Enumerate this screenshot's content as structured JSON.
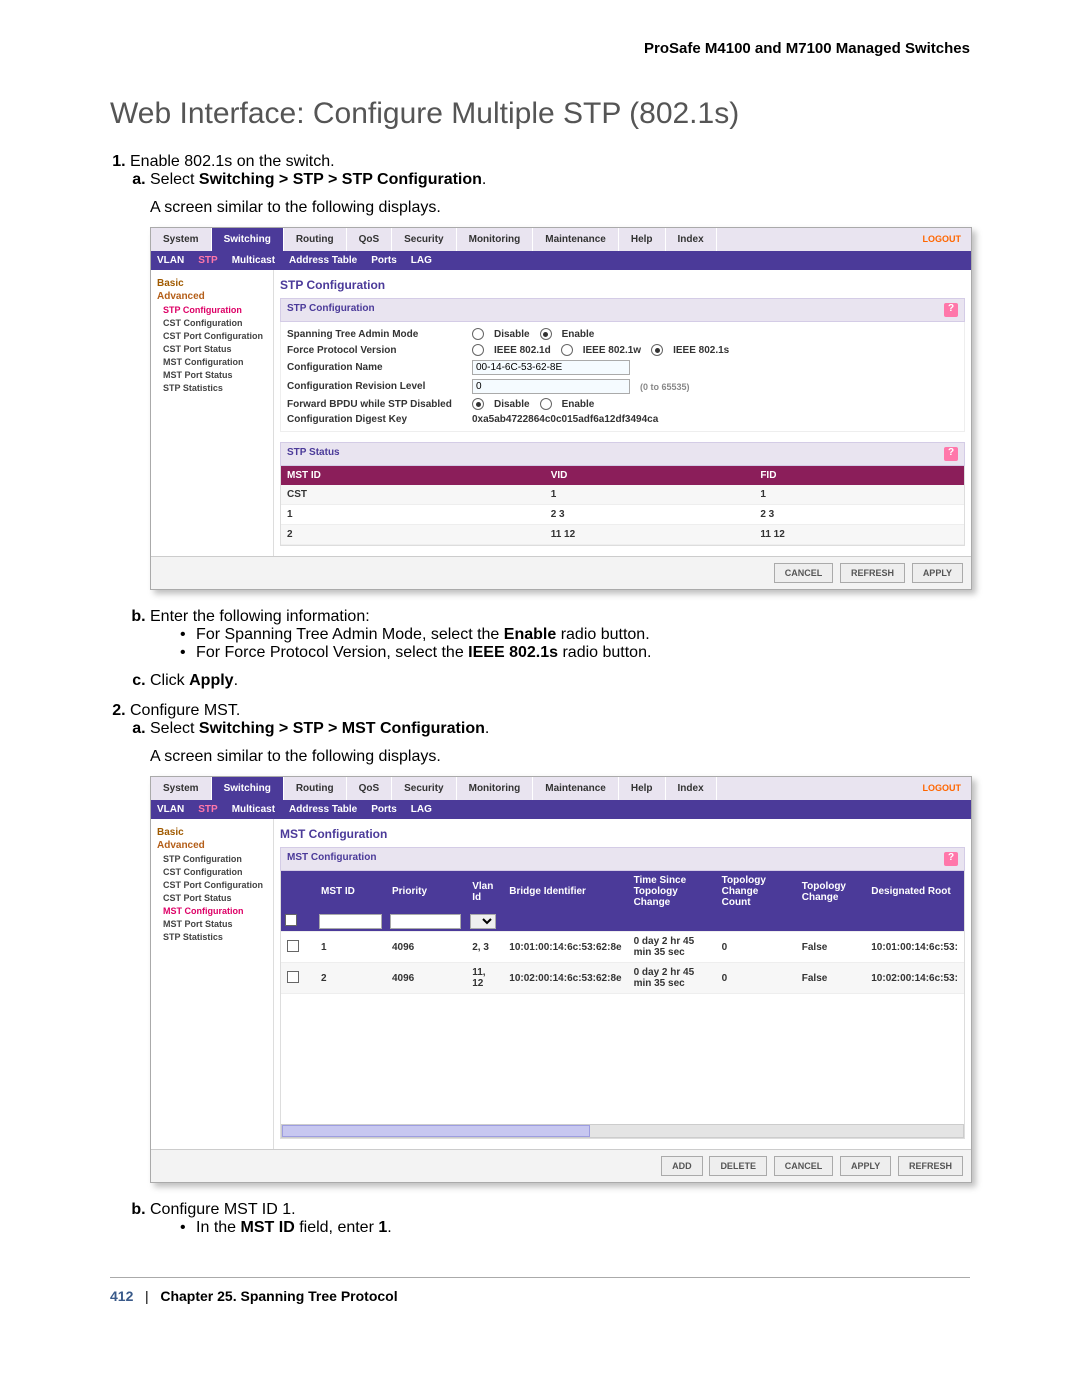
{
  "doc_header": "ProSafe M4100 and M7100 Managed Switches",
  "page_title": "Web Interface: Configure Multiple STP (802.1s)",
  "step1": {
    "text": "Enable 802.1s on the switch.",
    "a_prefix": "Select ",
    "a_path": "Switching > STP > STP Configuration",
    "a_suffix": ".",
    "a_desc": "A screen similar to the following displays.",
    "b_text": "Enter the following information:",
    "b_bullet1_pre": "For Spanning Tree Admin Mode, select the ",
    "b_bullet1_bold": "Enable",
    "b_bullet1_post": " radio button.",
    "b_bullet2_pre": "For Force Protocol Version, select the ",
    "b_bullet2_bold": "IEEE 802.1s",
    "b_bullet2_post": " radio button.",
    "c_pre": "Click ",
    "c_bold": "Apply",
    "c_post": "."
  },
  "step2": {
    "text": "Configure MST.",
    "a_prefix": "Select ",
    "a_path": "Switching > STP > MST Configuration",
    "a_suffix": ".",
    "a_desc": "A screen similar to the following displays.",
    "b_text": "Configure MST ID 1.",
    "b_bullet1_pre": "In the ",
    "b_bullet1_bold": "MST ID",
    "b_bullet1_mid": " field, enter ",
    "b_bullet1_bold2": "1",
    "b_bullet1_post": "."
  },
  "footer": {
    "page": "412",
    "sep": "|",
    "chapter": "Chapter 25.  Spanning Tree Protocol"
  },
  "ss_common": {
    "tabs": [
      "System",
      "Switching",
      "Routing",
      "QoS",
      "Security",
      "Monitoring",
      "Maintenance",
      "Help",
      "Index"
    ],
    "logout": "LOGOUT",
    "subnav": [
      "VLAN",
      "STP",
      "Multicast",
      "Address Table",
      "Ports",
      "LAG"
    ],
    "buttons": {
      "cancel": "CANCEL",
      "refresh": "REFRESH",
      "apply": "APPLY",
      "add": "ADD",
      "delete": "DELETE"
    }
  },
  "ss1": {
    "sidebar": {
      "basic": "Basic",
      "advanced": "Advanced",
      "items": [
        "STP Configuration",
        "CST Configuration",
        "CST Port Configuration",
        "CST Port Status",
        "MST Configuration",
        "MST Port Status",
        "STP Statistics"
      ]
    },
    "title": "STP Configuration",
    "panel1": "STP Configuration",
    "labels": {
      "admin": "Spanning Tree Admin Mode",
      "force": "Force Protocol Version",
      "confname": "Configuration Name",
      "revlevel": "Configuration Revision Level",
      "fwdbpdu": "Forward BPDU while STP Disabled",
      "digest": "Configuration Digest Key"
    },
    "values": {
      "disable": "Disable",
      "enable": "Enable",
      "ieee_d": "IEEE 802.1d",
      "ieee_w": "IEEE 802.1w",
      "ieee_s": "IEEE 802.1s",
      "confname": "00-14-6C-53-62-8E",
      "revlevel": "0",
      "revhint": "(0 to 65535)",
      "digest": "0xa5ab4722864c0c015adf6a12df3494ca"
    },
    "panel2": "STP Status",
    "table_headers": [
      "MST ID",
      "VID",
      "FID"
    ],
    "rows": [
      [
        "CST",
        "1",
        "1"
      ],
      [
        "1",
        "2 3",
        "2 3"
      ],
      [
        "2",
        "11 12",
        "11 12"
      ]
    ]
  },
  "ss2": {
    "sidebar": {
      "basic": "Basic",
      "advanced": "Advanced",
      "items": [
        "STP Configuration",
        "CST Configuration",
        "CST Port Configuration",
        "CST Port Status",
        "MST Configuration",
        "MST Port Status",
        "STP Statistics"
      ]
    },
    "title": "MST Configuration",
    "panel": "MST Configuration",
    "table_headers": [
      "",
      "MST ID",
      "Priority",
      "Vlan Id",
      "Bridge Identifier",
      "Time Since Topology Change",
      "Topology Change Count",
      "Topology Change",
      "Designated Root"
    ],
    "rows": [
      [
        "",
        "1",
        "4096",
        "2, 3",
        "10:01:00:14:6c:53:62:8e",
        "0 day 2 hr 45 min 35 sec",
        "0",
        "False",
        "10:01:00:14:6c:53:"
      ],
      [
        "",
        "2",
        "4096",
        "11, 12",
        "10:02:00:14:6c:53:62:8e",
        "0 day 2 hr 45 min 35 sec",
        "0",
        "False",
        "10:02:00:14:6c:53:"
      ]
    ]
  }
}
